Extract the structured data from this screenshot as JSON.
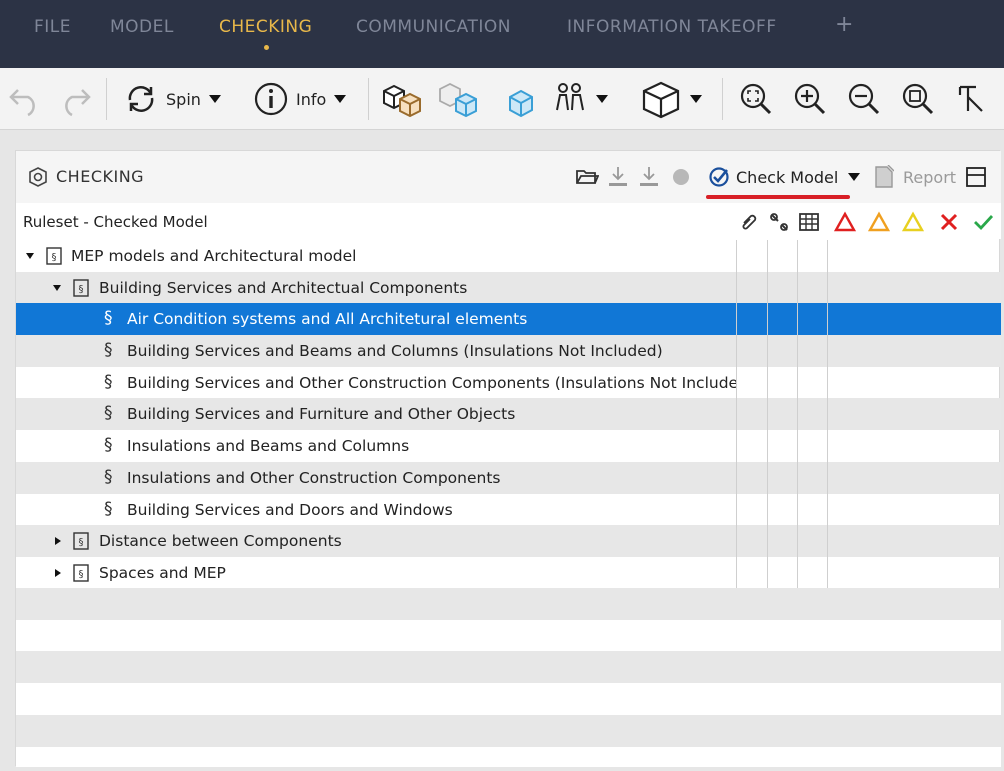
{
  "menu": {
    "items": [
      "FILE",
      "MODEL",
      "CHECKING",
      "COMMUNICATION",
      "INFORMATION TAKEOFF"
    ],
    "active": "CHECKING",
    "add_label": "+"
  },
  "toolbar": {
    "spin_label": "Spin",
    "info_label": "Info"
  },
  "panel": {
    "title": "CHECKING",
    "check_model_label": "Check Model",
    "report_label": "Report",
    "column_header": "Ruleset - Checked Model"
  },
  "tree": {
    "root": "MEP models and Architectural model",
    "group1": "Building Services and Architectual Components",
    "rules": [
      "Air Condition systems and All Architetural elements",
      "Building Services and Beams and Columns (Insulations Not Included)",
      "Building Services and Other Construction Components (Insulations Not Included)",
      "Building Services and Furniture and Other Objects",
      "Insulations and Beams and Columns",
      "Insulations and Other Construction Components",
      "Building Services and Doors and Windows"
    ],
    "group2": "Distance between Components",
    "group3": "Spaces and MEP",
    "rule_symbol": "§"
  },
  "colors": {
    "menu_bg": "#2c3345",
    "menu_active": "#e8b84a",
    "selection": "#1177d6",
    "underline": "#d81f26",
    "issue_red": "#e02020",
    "issue_orange": "#f0a020",
    "issue_yellow": "#e8d020",
    "ok_green": "#2aa84a"
  },
  "selected_rule_index": 0
}
